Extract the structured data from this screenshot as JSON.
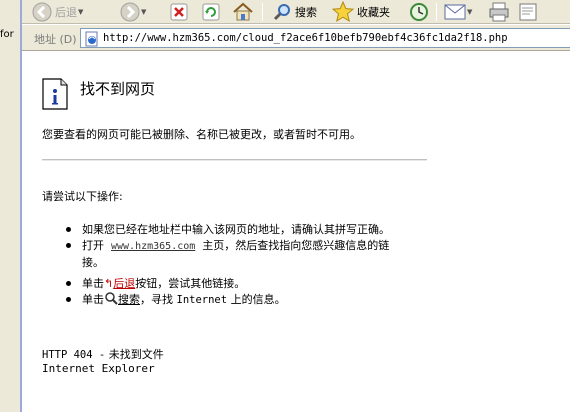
{
  "left_strip": {
    "fragment_text": "for"
  },
  "toolbar": {
    "back_label": "后退",
    "search_label": "搜索",
    "favorites_label": "收藏夹"
  },
  "address": {
    "label": "地址 (D)",
    "url": "http://www.hzm365.com/cloud_f2ace6f10befb790ebf4c36fc1da2f18.php"
  },
  "page": {
    "title": "找不到网页",
    "description": "您要查看的网页可能已被删除、名称已被更改，或者暂时不可用。",
    "try_heading": "请尝试以下操作:",
    "bullets": {
      "b1": "如果您已经在地址栏中输入该网页的地址，请确认其拼写正确。",
      "b2_prefix": "打开",
      "b2_link": "www.hzm365.com",
      "b2_suffix": "主页，然后查找指向您感兴趣信息的链",
      "b2_line2": "接。",
      "b3_prefix": "单击",
      "b3_link": "后退",
      "b3_suffix": "按钮，尝试其他链接。",
      "b4_prefix": "单击",
      "b4_link": "搜索",
      "b4_suffix": "，寻找",
      "b4_mono": "Internet",
      "b4_end": "上的信息。"
    },
    "error_line1_mono": "HTTP 404 -",
    "error_line1_text": "未找到文件",
    "error_line2": "Internet Explorer"
  },
  "icons": {
    "back": "back-arrow-icon",
    "forward": "forward-arrow-icon",
    "stop": "stop-icon",
    "refresh": "refresh-icon",
    "home": "home-icon",
    "search": "search-icon",
    "favorites": "favorites-star-icon",
    "history": "history-icon",
    "mail": "mail-icon",
    "print": "print-icon",
    "edit": "edit-icon"
  }
}
